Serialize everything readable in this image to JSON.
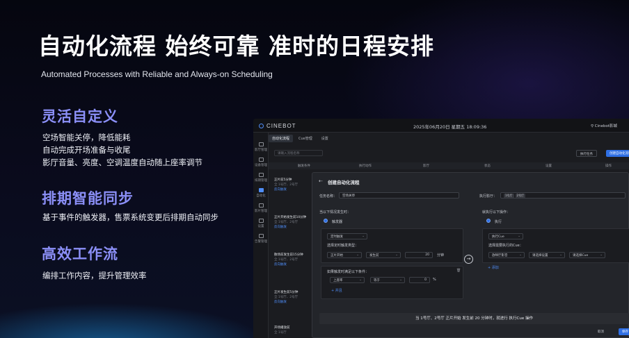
{
  "hero": {
    "title": "自动化流程 始终可靠 准时的日程安排",
    "subtitle": "Automated Processes with Reliable and Always-on Scheduling"
  },
  "features": [
    {
      "heading": "灵活自定义",
      "lines": [
        "空场智能关停，降低能耗",
        "自动完成开场准备与收尾",
        "影厅音量、亮度、空调温度自动随上座率调节"
      ]
    },
    {
      "heading": "排期智能同步",
      "lines": [
        "基于事件的触发器，售票系统变更后排期自动同步"
      ]
    },
    {
      "heading": "高效工作流",
      "lines": [
        "编排工作内容，提升管理效率"
      ]
    }
  ],
  "app": {
    "logo": "CINEBOT",
    "datetime": "2025年06月20日 星期五 18:09:36",
    "cinema": "Cinebot影城",
    "sidebar": [
      "影厅管理",
      "设备管理",
      "排期管理",
      "自动化",
      "影片管理",
      "设置",
      "告警管理"
    ],
    "tabs": [
      "自动化流程",
      "Cue管理",
      "设置"
    ],
    "search_placeholder": "请输入流程名称",
    "btn_run": "执行任务",
    "btn_create": "创建自动化流程",
    "table_headers": [
      "触发条件",
      "执行动作",
      "影厅",
      "状态",
      "设置",
      "操作"
    ],
    "rows": [
      {
        "title": "正片前5分钟",
        "meta": "全 1号厅、2号厅",
        "link": "反向触发"
      },
      {
        "title": "正片开始发生前10分钟",
        "meta": "全 1号厅、2号厅",
        "link": "反向触发"
      },
      {
        "title": "散场前发生前15分钟",
        "meta": "全 1号厅、2号厅",
        "link": "反向触发"
      },
      {
        "title": "正片发生前5分钟",
        "meta": "全 1号厅、2号厅",
        "link": "反向触发"
      },
      {
        "title": "开场播放前",
        "meta": "全 1号厅",
        "link": "反向触发"
      }
    ]
  },
  "modal": {
    "title": "创建自动化流程",
    "task_name_label": "任务名称：",
    "task_name_value": "空场关停",
    "exec_hall_label": "执行影厅：",
    "exec_hall_chips": [
      "1号厅",
      "2号厅"
    ],
    "trigger_heading": "当以下情况发生时：",
    "trigger_option": "触发器",
    "trigger_type": "定时触发",
    "trigger_type_label": "选择定时触发类型：",
    "trigger_fields": [
      "正片开始",
      "发生前",
      "20",
      "分钟"
    ],
    "condition_heading": "如果触发时满足以下条件：",
    "condition_fields": [
      "上座率",
      "等于",
      "0",
      "%"
    ],
    "add_condition": "+ 并且",
    "action_heading": "就执行以下操作：",
    "action_option": "执行",
    "action_type": "执行Cue",
    "action_select_label": "选择需要执行的Cue：",
    "action_fields": [
      "放映厅影音",
      "请选择设置",
      "请选择Cue"
    ],
    "add_action": "+ 添加",
    "summary": "当 1号厅、2号厅 正片开始 发生前 20 分钟时，就进行 执行Cue 操作",
    "cancel": "取消",
    "save": "保存"
  }
}
